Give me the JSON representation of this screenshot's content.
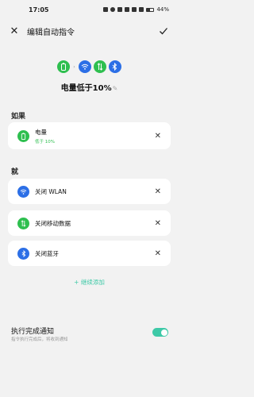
{
  "status_bar": {
    "time": "17:05",
    "battery": "44%",
    "battery_level": 0.44
  },
  "header": {
    "title": "编辑自动指令"
  },
  "rule": {
    "name": "电量低于10%",
    "flow_icons": [
      "battery-icon",
      "wifi-icon",
      "mobile-data-icon",
      "bluetooth-icon"
    ]
  },
  "if_section": {
    "label": "如果",
    "condition": {
      "title": "电量",
      "detail": "低于 10%",
      "icon": "battery-icon",
      "color": "#2ebf4f"
    }
  },
  "then_section": {
    "label": "就",
    "actions": [
      {
        "label": "关闭 WLAN",
        "icon": "wifi-icon",
        "color": "#2c6fe6"
      },
      {
        "label": "关闭移动数据",
        "icon": "mobile-data-icon",
        "color": "#2ebf4f"
      },
      {
        "label": "关闭蓝牙",
        "icon": "bluetooth-icon",
        "color": "#2c6fe6"
      }
    ],
    "add_label": "+ 继续添加"
  },
  "notification": {
    "title": "执行完成通知",
    "subtitle": "指令执行完成后，将收到通知",
    "enabled": true
  },
  "colors": {
    "accent": "#3ec9a7",
    "green": "#2ebf4f",
    "blue": "#2c6fe6",
    "background": "#f2f2f2"
  }
}
